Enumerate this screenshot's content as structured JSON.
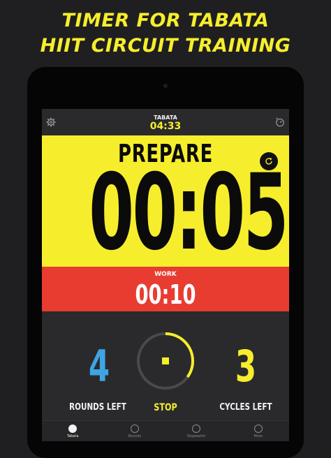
{
  "headline": {
    "line1": "TIMER FOR TABATA",
    "line2": "HIIT CIRCUIT TRAINING"
  },
  "colors": {
    "accent_yellow": "#f6ee2c",
    "work_red": "#e93c31",
    "rounds_blue": "#3fa4e4",
    "background": "#1f1f21"
  },
  "topbar": {
    "settings_icon": "gear-icon",
    "mode_label": "TABATA",
    "total_time": "04:33",
    "timer_icon": "timer-icon"
  },
  "main": {
    "phase": "PREPARE",
    "countdown": "00:05",
    "reset_icon": "reset-icon"
  },
  "next": {
    "label": "WORK",
    "time": "00:10"
  },
  "stats": {
    "rounds_value": "4",
    "rounds_label": "ROUNDS LEFT",
    "cycles_value": "3",
    "cycles_label": "CYCLES LEFT",
    "stop_label": "STOP",
    "ring_progress": 0.35
  },
  "tabs": [
    {
      "label": "Tabata",
      "active": true
    },
    {
      "label": "Rounds",
      "active": false
    },
    {
      "label": "Stopwatch",
      "active": false
    },
    {
      "label": "More",
      "active": false
    }
  ]
}
